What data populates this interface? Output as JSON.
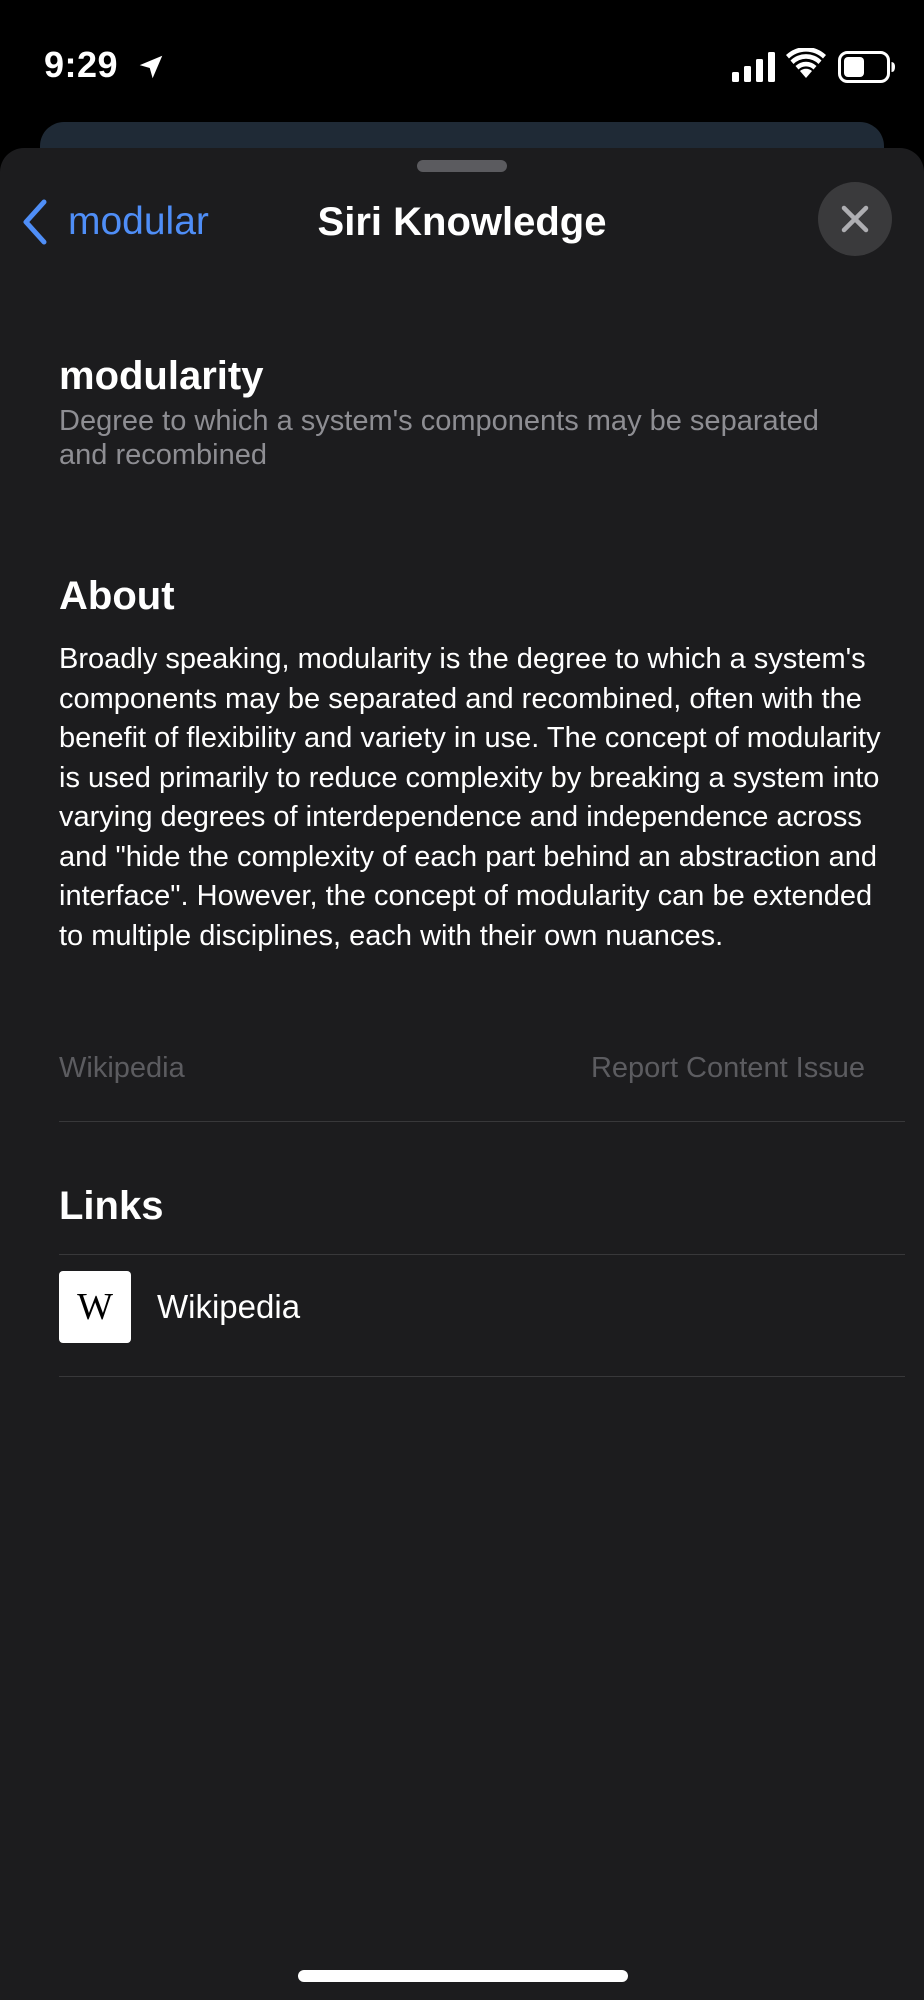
{
  "status_bar": {
    "time": "9:29",
    "location_icon": "location-arrow-icon",
    "signal_icon": "cellular-signal-icon",
    "wifi_icon": "wifi-icon",
    "battery_icon": "battery-icon"
  },
  "header": {
    "back_label": "modular",
    "title": "Siri Knowledge",
    "back_icon": "chevron-left-icon",
    "close_icon": "close-icon"
  },
  "topic": {
    "title": "modularity",
    "subtitle": "Degree to which a system's components may be separated and recombined"
  },
  "about": {
    "heading": "About",
    "body": "Broadly speaking, modularity is the degree to which a system's components may be separated and recombined, often with the benefit of flexibility and variety in use. The concept of modularity is used primarily to reduce complexity by breaking a system into varying degrees of interdependence and independence across and \"hide the complexity of each part behind an abstraction and interface\". However, the concept of modularity can be extended to multiple disciplines, each with their own nuances.",
    "source": "Wikipedia",
    "report": "Report Content Issue"
  },
  "links": {
    "heading": "Links",
    "items": [
      {
        "logo_text": "W",
        "label": "Wikipedia"
      }
    ]
  },
  "colors": {
    "accent": "#4f8ef7",
    "sheet_background": "#1c1c1e",
    "secondary_text": "#8e8e93"
  }
}
